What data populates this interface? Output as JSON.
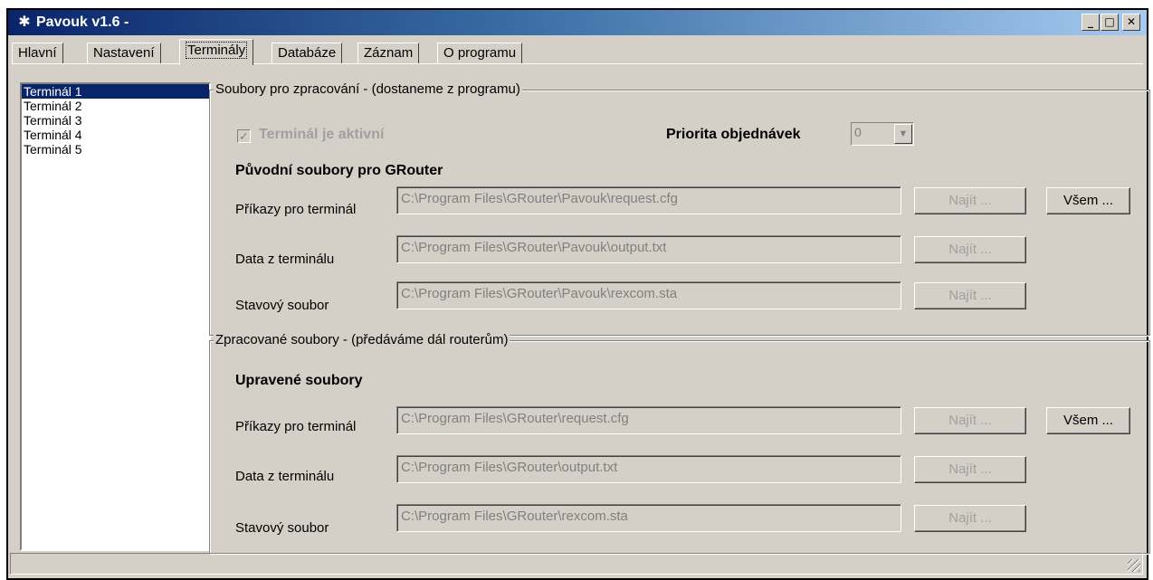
{
  "window": {
    "title": "Pavouk v1.6 -",
    "minimize": "_",
    "maximize": "□",
    "close": "✕",
    "icon": "spider-icon"
  },
  "tabs": [
    "Hlavní",
    "Nastavení",
    "Terminály",
    "Databáze",
    "Záznam",
    "O programu"
  ],
  "active_tab": "Terminály",
  "terminal_list": {
    "items": [
      "Terminál 1",
      "Terminál 2",
      "Terminál 3",
      "Terminál 4",
      "Terminál 5"
    ],
    "selected": "Terminál 1"
  },
  "source_group": {
    "legend": "Soubory pro zpracování - (dostaneme z programu)",
    "active_checkbox_label": "Terminál je aktivní",
    "active_checked": true,
    "priority_label": "Priorita objednávek",
    "priority_value": "0",
    "heading": "Původní soubory pro GRouter",
    "rows": [
      {
        "label": "Příkazy pro terminál",
        "value": "C:\\Program Files\\GRouter\\Pavouk\\request.cfg",
        "button": "Najít ..."
      },
      {
        "label": "Data z terminálu",
        "value": "C:\\Program Files\\GRouter\\Pavouk\\output.txt",
        "button": "Najít ..."
      },
      {
        "label": "Stavový soubor",
        "value": "C:\\Program Files\\GRouter\\Pavouk\\rexcom.sta",
        "button": "Najít ..."
      }
    ],
    "all_button": "Všem ..."
  },
  "processed_group": {
    "legend": "Zpracované soubory - (předáváme dál routerům)",
    "heading": "Upravené soubory",
    "rows": [
      {
        "label": "Příkazy pro terminál",
        "value": "C:\\Program Files\\GRouter\\request.cfg",
        "button": "Najít ..."
      },
      {
        "label": "Data z terminálu",
        "value": "C:\\Program Files\\GRouter\\output.txt",
        "button": "Najít ..."
      },
      {
        "label": "Stavový soubor",
        "value": "C:\\Program Files\\GRouter\\rexcom.sta",
        "button": "Najít ..."
      }
    ],
    "all_button": "Všem ..."
  },
  "colors": {
    "titlebar_start": "#0a246a",
    "titlebar_end": "#a6caf0",
    "face": "#d4d0c8",
    "selection": "#0a246a"
  }
}
